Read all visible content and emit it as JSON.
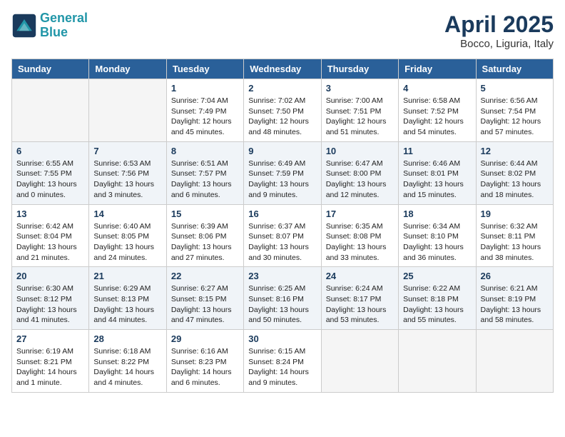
{
  "header": {
    "logo_line1": "General",
    "logo_line2": "Blue",
    "month": "April 2025",
    "location": "Bocco, Liguria, Italy"
  },
  "days_of_week": [
    "Sunday",
    "Monday",
    "Tuesday",
    "Wednesday",
    "Thursday",
    "Friday",
    "Saturday"
  ],
  "weeks": [
    [
      {
        "day": "",
        "info": ""
      },
      {
        "day": "",
        "info": ""
      },
      {
        "day": "1",
        "info": "Sunrise: 7:04 AM\nSunset: 7:49 PM\nDaylight: 12 hours\nand 45 minutes."
      },
      {
        "day": "2",
        "info": "Sunrise: 7:02 AM\nSunset: 7:50 PM\nDaylight: 12 hours\nand 48 minutes."
      },
      {
        "day": "3",
        "info": "Sunrise: 7:00 AM\nSunset: 7:51 PM\nDaylight: 12 hours\nand 51 minutes."
      },
      {
        "day": "4",
        "info": "Sunrise: 6:58 AM\nSunset: 7:52 PM\nDaylight: 12 hours\nand 54 minutes."
      },
      {
        "day": "5",
        "info": "Sunrise: 6:56 AM\nSunset: 7:54 PM\nDaylight: 12 hours\nand 57 minutes."
      }
    ],
    [
      {
        "day": "6",
        "info": "Sunrise: 6:55 AM\nSunset: 7:55 PM\nDaylight: 13 hours\nand 0 minutes."
      },
      {
        "day": "7",
        "info": "Sunrise: 6:53 AM\nSunset: 7:56 PM\nDaylight: 13 hours\nand 3 minutes."
      },
      {
        "day": "8",
        "info": "Sunrise: 6:51 AM\nSunset: 7:57 PM\nDaylight: 13 hours\nand 6 minutes."
      },
      {
        "day": "9",
        "info": "Sunrise: 6:49 AM\nSunset: 7:59 PM\nDaylight: 13 hours\nand 9 minutes."
      },
      {
        "day": "10",
        "info": "Sunrise: 6:47 AM\nSunset: 8:00 PM\nDaylight: 13 hours\nand 12 minutes."
      },
      {
        "day": "11",
        "info": "Sunrise: 6:46 AM\nSunset: 8:01 PM\nDaylight: 13 hours\nand 15 minutes."
      },
      {
        "day": "12",
        "info": "Sunrise: 6:44 AM\nSunset: 8:02 PM\nDaylight: 13 hours\nand 18 minutes."
      }
    ],
    [
      {
        "day": "13",
        "info": "Sunrise: 6:42 AM\nSunset: 8:04 PM\nDaylight: 13 hours\nand 21 minutes."
      },
      {
        "day": "14",
        "info": "Sunrise: 6:40 AM\nSunset: 8:05 PM\nDaylight: 13 hours\nand 24 minutes."
      },
      {
        "day": "15",
        "info": "Sunrise: 6:39 AM\nSunset: 8:06 PM\nDaylight: 13 hours\nand 27 minutes."
      },
      {
        "day": "16",
        "info": "Sunrise: 6:37 AM\nSunset: 8:07 PM\nDaylight: 13 hours\nand 30 minutes."
      },
      {
        "day": "17",
        "info": "Sunrise: 6:35 AM\nSunset: 8:08 PM\nDaylight: 13 hours\nand 33 minutes."
      },
      {
        "day": "18",
        "info": "Sunrise: 6:34 AM\nSunset: 8:10 PM\nDaylight: 13 hours\nand 36 minutes."
      },
      {
        "day": "19",
        "info": "Sunrise: 6:32 AM\nSunset: 8:11 PM\nDaylight: 13 hours\nand 38 minutes."
      }
    ],
    [
      {
        "day": "20",
        "info": "Sunrise: 6:30 AM\nSunset: 8:12 PM\nDaylight: 13 hours\nand 41 minutes."
      },
      {
        "day": "21",
        "info": "Sunrise: 6:29 AM\nSunset: 8:13 PM\nDaylight: 13 hours\nand 44 minutes."
      },
      {
        "day": "22",
        "info": "Sunrise: 6:27 AM\nSunset: 8:15 PM\nDaylight: 13 hours\nand 47 minutes."
      },
      {
        "day": "23",
        "info": "Sunrise: 6:25 AM\nSunset: 8:16 PM\nDaylight: 13 hours\nand 50 minutes."
      },
      {
        "day": "24",
        "info": "Sunrise: 6:24 AM\nSunset: 8:17 PM\nDaylight: 13 hours\nand 53 minutes."
      },
      {
        "day": "25",
        "info": "Sunrise: 6:22 AM\nSunset: 8:18 PM\nDaylight: 13 hours\nand 55 minutes."
      },
      {
        "day": "26",
        "info": "Sunrise: 6:21 AM\nSunset: 8:19 PM\nDaylight: 13 hours\nand 58 minutes."
      }
    ],
    [
      {
        "day": "27",
        "info": "Sunrise: 6:19 AM\nSunset: 8:21 PM\nDaylight: 14 hours\nand 1 minute."
      },
      {
        "day": "28",
        "info": "Sunrise: 6:18 AM\nSunset: 8:22 PM\nDaylight: 14 hours\nand 4 minutes."
      },
      {
        "day": "29",
        "info": "Sunrise: 6:16 AM\nSunset: 8:23 PM\nDaylight: 14 hours\nand 6 minutes."
      },
      {
        "day": "30",
        "info": "Sunrise: 6:15 AM\nSunset: 8:24 PM\nDaylight: 14 hours\nand 9 minutes."
      },
      {
        "day": "",
        "info": ""
      },
      {
        "day": "",
        "info": ""
      },
      {
        "day": "",
        "info": ""
      }
    ]
  ]
}
